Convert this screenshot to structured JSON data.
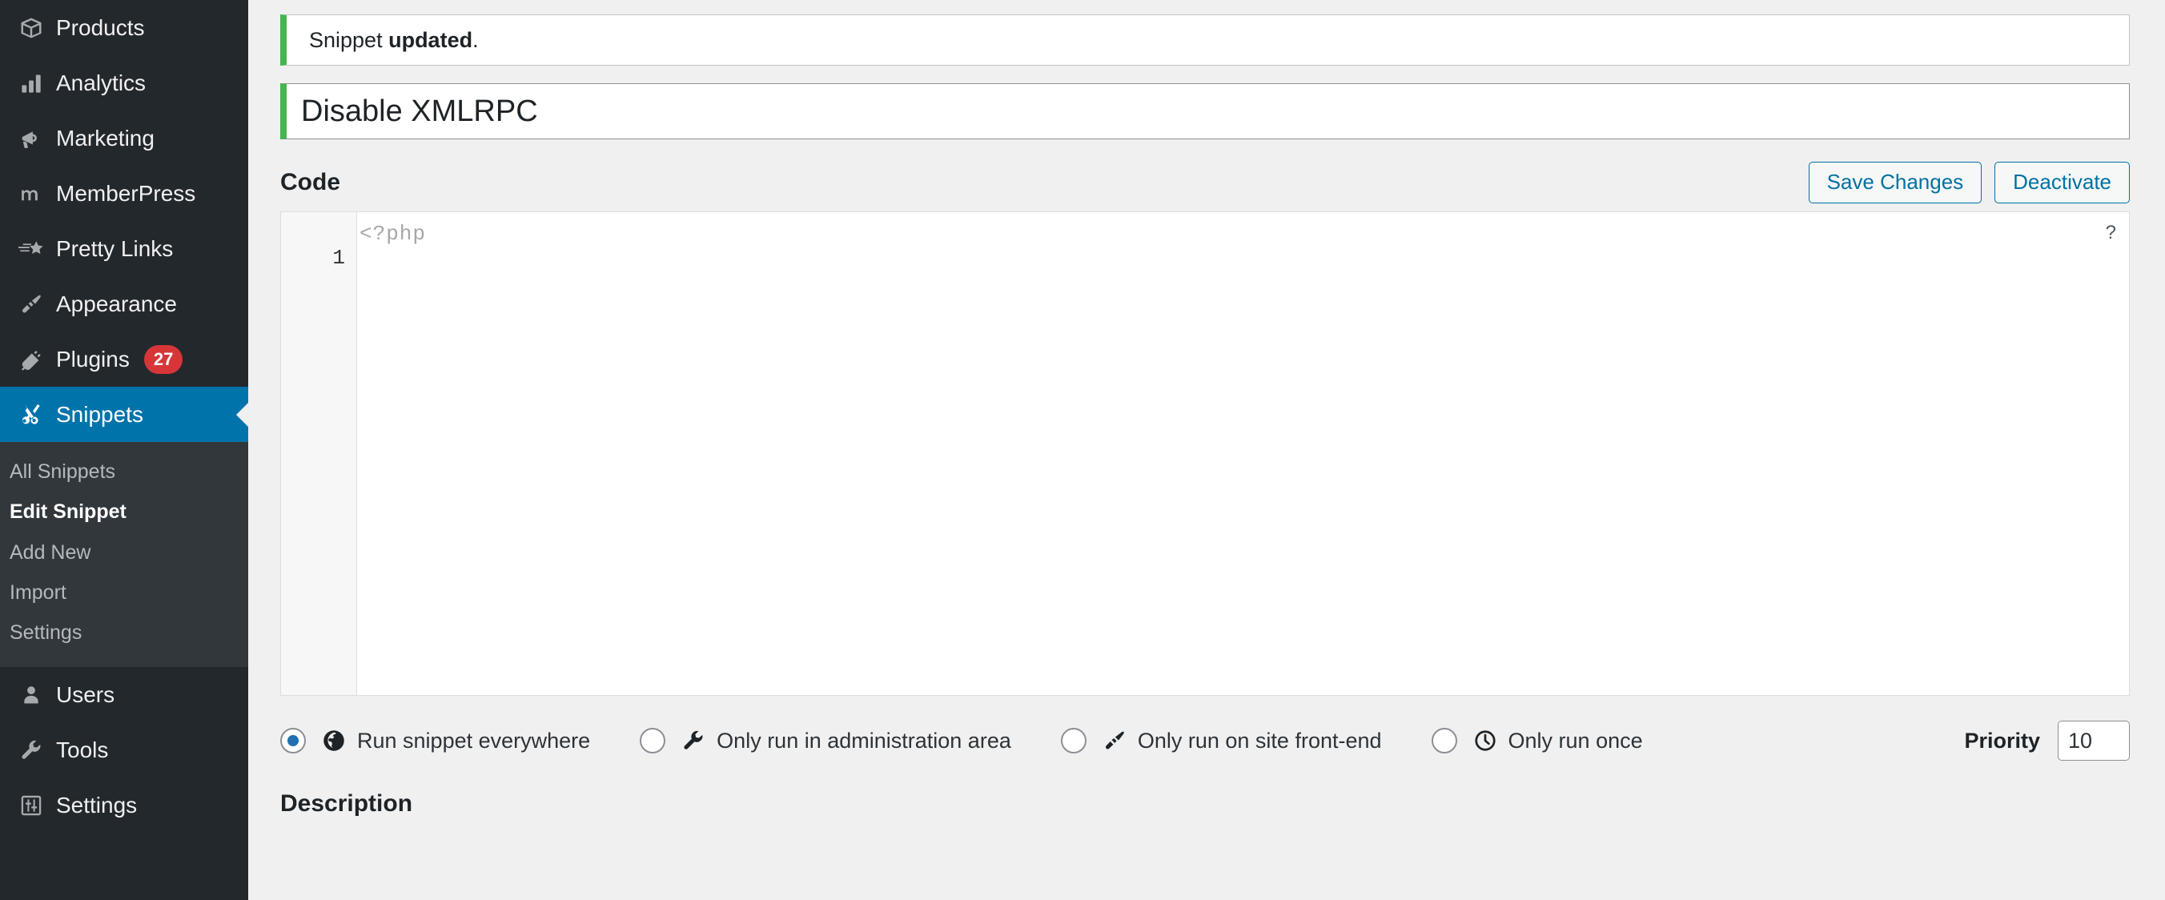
{
  "sidebar": {
    "items": [
      {
        "label": "Products",
        "icon": "box-icon",
        "badge": null,
        "current": false
      },
      {
        "label": "Analytics",
        "icon": "bar-chart-icon",
        "badge": null,
        "current": false
      },
      {
        "label": "Marketing",
        "icon": "megaphone-icon",
        "badge": null,
        "current": false
      },
      {
        "label": "MemberPress",
        "icon": "memberpress-m-icon",
        "badge": null,
        "current": false
      },
      {
        "label": "Pretty Links",
        "icon": "comet-star-icon",
        "badge": null,
        "current": false
      },
      {
        "label": "Appearance",
        "icon": "paintbrush-icon",
        "badge": null,
        "current": false
      },
      {
        "label": "Plugins",
        "icon": "plug-icon",
        "badge": "27",
        "current": false
      },
      {
        "label": "Snippets",
        "icon": "scissors-icon",
        "badge": null,
        "current": true
      }
    ],
    "submenu": [
      {
        "label": "All Snippets",
        "current": false
      },
      {
        "label": "Edit Snippet",
        "current": true
      },
      {
        "label": "Add New",
        "current": false
      },
      {
        "label": "Import",
        "current": false
      },
      {
        "label": "Settings",
        "current": false
      }
    ],
    "bottom_items": [
      {
        "label": "Users",
        "icon": "user-icon"
      },
      {
        "label": "Tools",
        "icon": "wrench-icon"
      },
      {
        "label": "Settings",
        "icon": "sliders-icon"
      }
    ],
    "accent_color": "#0073aa",
    "badge_color": "#d63638"
  },
  "notice": {
    "text_prefix": "Snippet ",
    "text_bold": "updated",
    "text_suffix": ".",
    "accent_color": "#46b450"
  },
  "title_field": {
    "value": "Disable XMLRPC",
    "placeholder": "Enter title here",
    "accent_color": "#46b450"
  },
  "code_section": {
    "heading": "Code",
    "save_label": "Save Changes",
    "deactivate_label": "Deactivate",
    "php_tag": "<?php",
    "line_number": "1",
    "help_icon": "?",
    "editor_value": "",
    "button_color": "#0071a1"
  },
  "scope": {
    "options": [
      {
        "label": "Run snippet everywhere",
        "icon": "globe-icon",
        "checked": true
      },
      {
        "label": "Only run in administration area",
        "icon": "wrench-icon",
        "checked": false
      },
      {
        "label": "Only run on site front-end",
        "icon": "pin-icon",
        "checked": false
      },
      {
        "label": "Only run once",
        "icon": "clock-icon",
        "checked": false
      }
    ],
    "priority_label": "Priority",
    "priority_value": "10",
    "checked_color": "#2271b1"
  },
  "description": {
    "heading": "Description"
  }
}
